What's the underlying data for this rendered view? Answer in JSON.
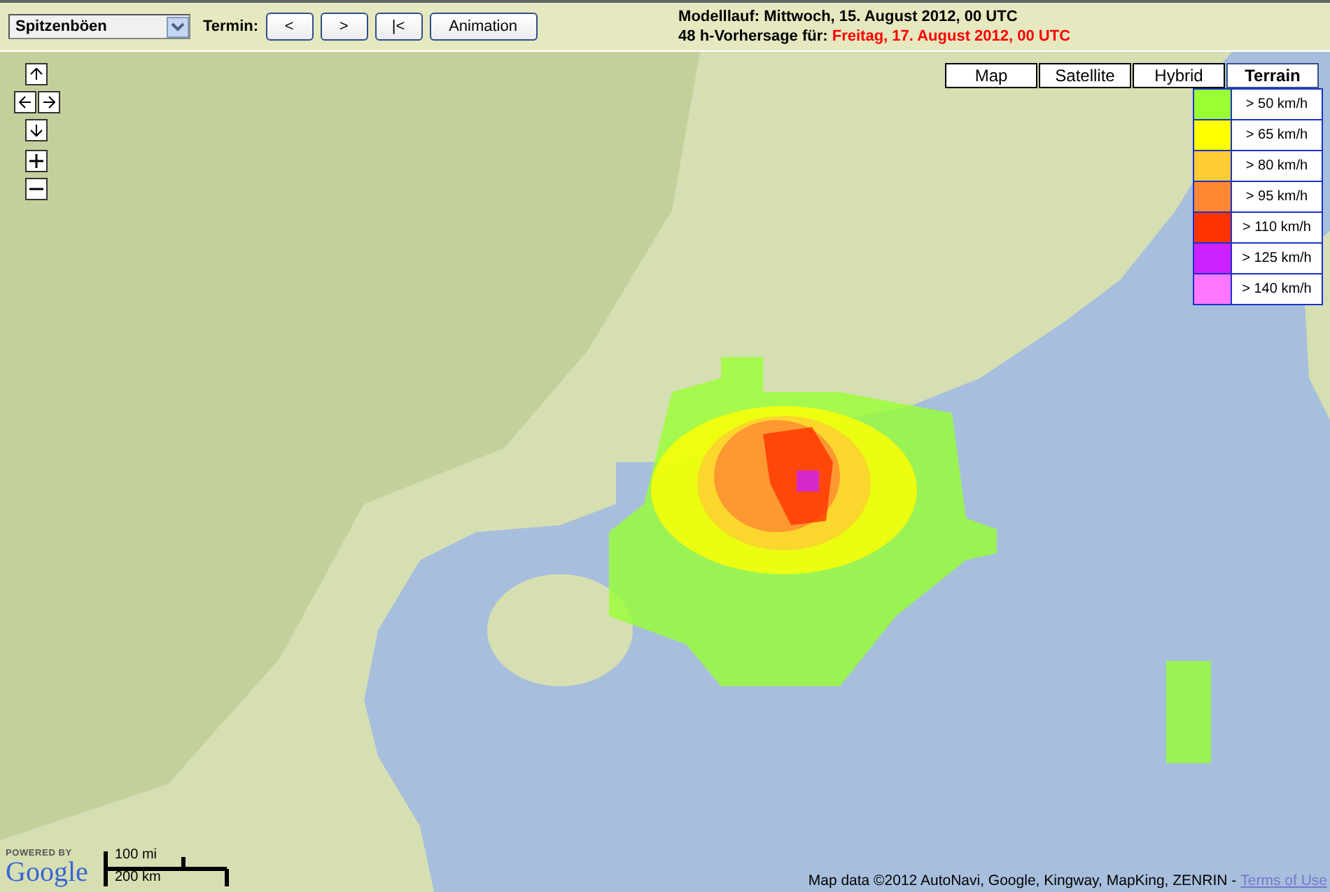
{
  "product_select": {
    "value": "Spitzenböen"
  },
  "termin_label": "Termin:",
  "nav_buttons": [
    "<",
    ">",
    "|<",
    "Animation"
  ],
  "model_run": "Modelllauf: Mittwoch, 15. August 2012, 00 UTC",
  "forecast": {
    "label": "48 h-Vorhersage für:",
    "value": "Freitag, 17. August 2012, 00 UTC"
  },
  "map_types": [
    {
      "label": "Map",
      "selected": false
    },
    {
      "label": "Satellite",
      "selected": false
    },
    {
      "label": "Hybrid",
      "selected": false
    },
    {
      "label": "Terrain",
      "selected": true
    }
  ],
  "legend": [
    {
      "label": "> 50 km/h",
      "color": "#99ff33"
    },
    {
      "label": "> 65 km/h",
      "color": "#ffff00"
    },
    {
      "label": "> 80 km/h",
      "color": "#ffcc33"
    },
    {
      "label": "> 95 km/h",
      "color": "#ff8833"
    },
    {
      "label": "> 110 km/h",
      "color": "#ff3300"
    },
    {
      "label": "> 125 km/h",
      "color": "#cc22ff"
    },
    {
      "label": "> 140 km/h",
      "color": "#ff77ff"
    }
  ],
  "logo": {
    "powered_by": "POWERED BY",
    "name": "Google"
  },
  "scale": [
    "100 mi",
    "200 km"
  ],
  "attribution": "Map data ©2012 AutoNavi, Google, Kingway, MapKing, ZENRIN -",
  "terms_link": "Terms of Use"
}
